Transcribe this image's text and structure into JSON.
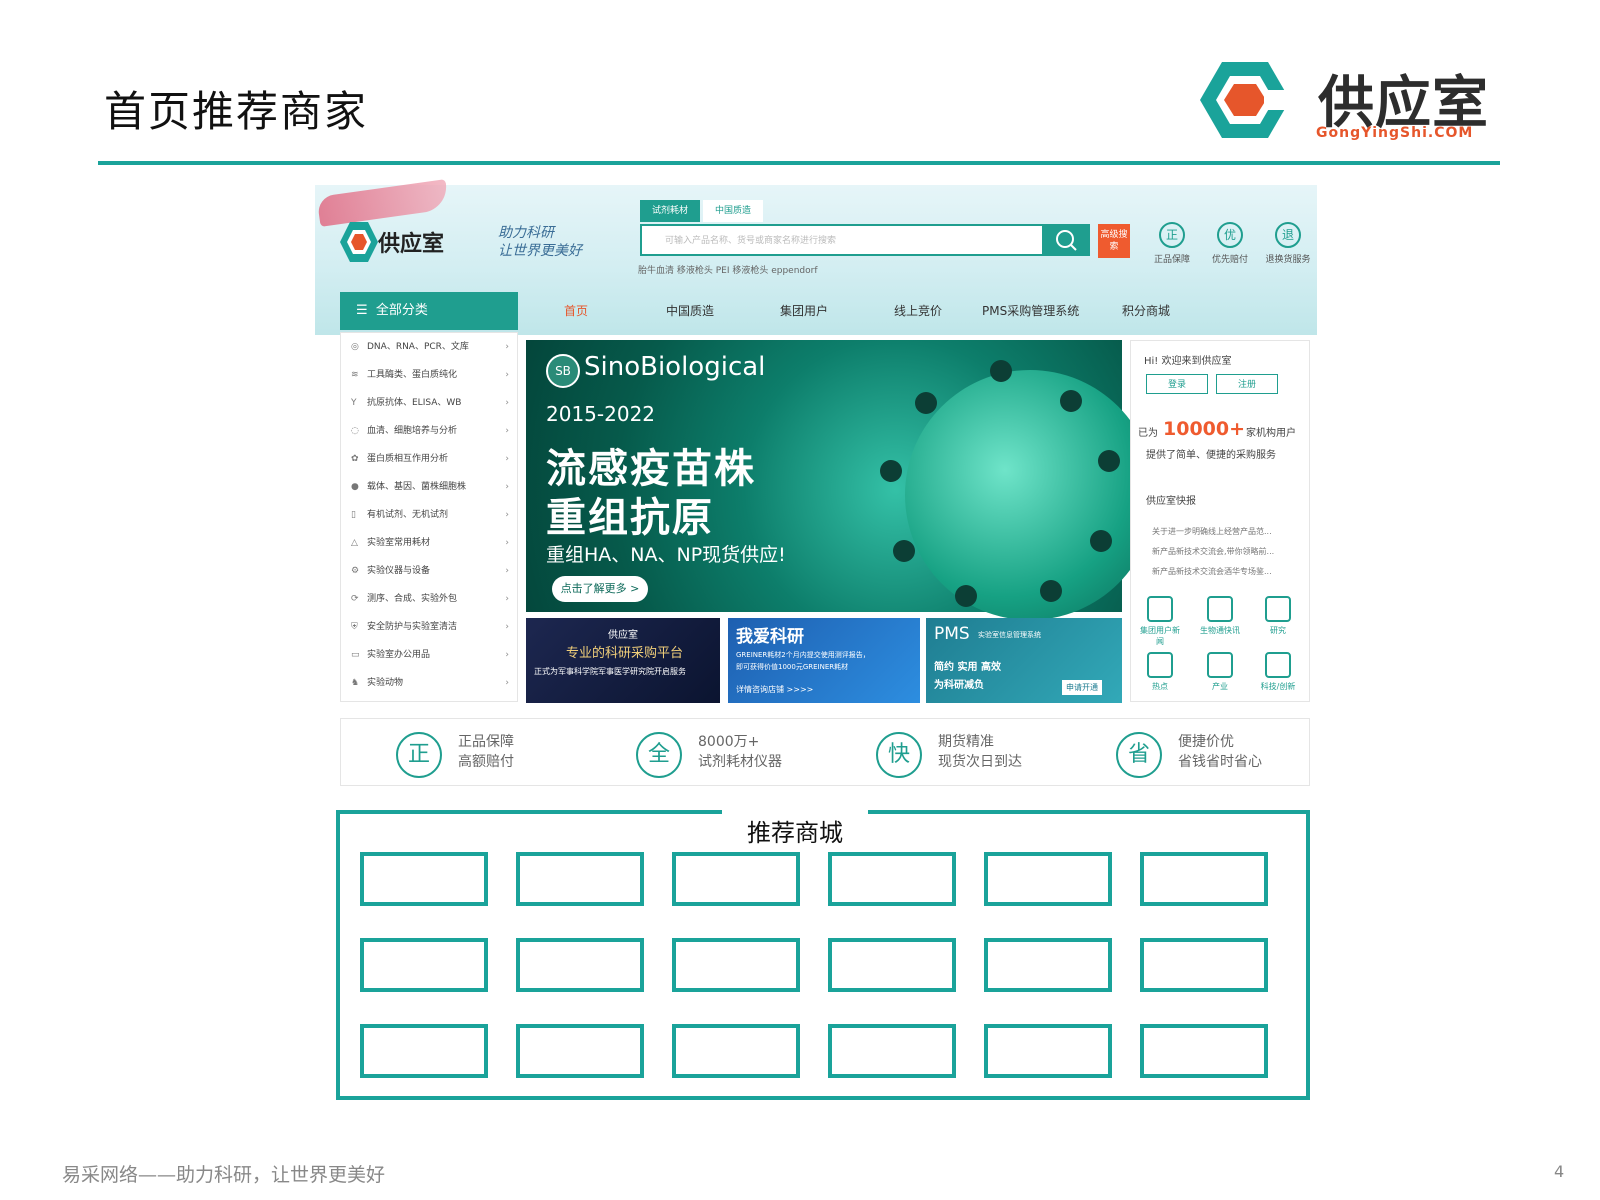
{
  "slide": {
    "title": "首页推荐商家",
    "brand_name": "供应室",
    "brand_url": "GongYingShi.COM",
    "footer": "易采网络——助力科研，让世界更美好",
    "page_number": "4",
    "accent_color": "#1aa39a"
  },
  "site_header": {
    "logo_text": "供应室",
    "slogan_line1": "助力科研",
    "slogan_line2": "让世界更美好",
    "search_tabs": [
      "试剂耗材",
      "中国质造"
    ],
    "search_placeholder": "可输入产品名称、货号或商家名称进行搜索",
    "advanced_search": "高级搜索",
    "hot_keywords": "胎牛血清   移液枪头   PEI   移液枪头   eppendorf",
    "services": [
      {
        "icon": "正",
        "label": "正品保障"
      },
      {
        "icon": "优",
        "label": "优先赔付"
      },
      {
        "icon": "退",
        "label": "退换货服务"
      }
    ]
  },
  "nav": {
    "all_categories": "全部分类",
    "items": [
      "首页",
      "中国质造",
      "集团用户",
      "线上竞价",
      "PMS采购管理系统",
      "积分商城"
    ]
  },
  "categories": [
    {
      "icon": "dna-icon",
      "label": "DNA、RNA、PCR、文库"
    },
    {
      "icon": "enzyme-icon",
      "label": "工具酶类、蛋白质纯化"
    },
    {
      "icon": "antibody-icon",
      "label": "抗原抗体、ELISA、WB"
    },
    {
      "icon": "cell-icon",
      "label": "血清、细胞培养与分析"
    },
    {
      "icon": "protein-icon",
      "label": "蛋白质相互作用分析"
    },
    {
      "icon": "vector-icon",
      "label": "载体、基因、菌株细胞株"
    },
    {
      "icon": "bottle-icon",
      "label": "有机试剂、无机试剂"
    },
    {
      "icon": "flask-icon",
      "label": "实验室常用耗材"
    },
    {
      "icon": "instrument-icon",
      "label": "实验仪器与设备"
    },
    {
      "icon": "service-icon",
      "label": "测序、合成、实验外包"
    },
    {
      "icon": "safety-icon",
      "label": "安全防护与实验室清洁"
    },
    {
      "icon": "office-icon",
      "label": "实验室办公用品"
    },
    {
      "icon": "animal-icon",
      "label": "实验动物"
    }
  ],
  "banner": {
    "brand": "SinoBiological",
    "badge": "SB",
    "years": "2015-2022",
    "headline1": "流感疫苗株",
    "headline2": "重组抗原",
    "subline": "重组HA、NA、NP现货供应!",
    "more": "点击了解更多 >"
  },
  "small_banners": [
    {
      "title": "供应室",
      "line1": "专业的科研采购平台",
      "line2": "正式为军事科学院军事医学研究院开启服务"
    },
    {
      "title": "我爱科研",
      "line1": "GREINER耗材2个月内提交使用测评报告，",
      "line2": "即可获得价值1000元GREINER耗材",
      "cta": "详情咨询店铺 >>>>"
    },
    {
      "title": "PMS",
      "line1": "实验室信息管理系统",
      "line2": "简约 实用 高效",
      "line3": "为科研减负",
      "cta": "申请开通"
    }
  ],
  "right_panel": {
    "welcome": "Hi! 欢迎来到供应室",
    "login": "登录",
    "register": "注册",
    "users_prefix": "已为",
    "users_count": "10000+",
    "users_suffix": "家机构用户",
    "users_line2": "提供了简单、便捷的采购服务",
    "news_title": "供应室快报",
    "news": [
      "关于进一步明确线上经营产品范...",
      "新产品新技术交流会,带你领略前...",
      "新产品新技术交流会酒华专场鉴..."
    ],
    "quick_links": [
      "集团用户新闻",
      "生物通快讯",
      "研究",
      "热点",
      "产业",
      "科技/创新"
    ]
  },
  "features": [
    {
      "icon": "正",
      "line1": "正品保障",
      "line2": "高额赔付"
    },
    {
      "icon": "全",
      "line1": "8000万+",
      "line2": "试剂耗材仪器"
    },
    {
      "icon": "快",
      "line1": "期货精准",
      "line2": "现货次日到达"
    },
    {
      "icon": "省",
      "line1": "便捷价优",
      "line2": "省钱省时省心"
    }
  ],
  "recommend": {
    "label": "推荐商城",
    "rows": 3,
    "cols": 6
  }
}
